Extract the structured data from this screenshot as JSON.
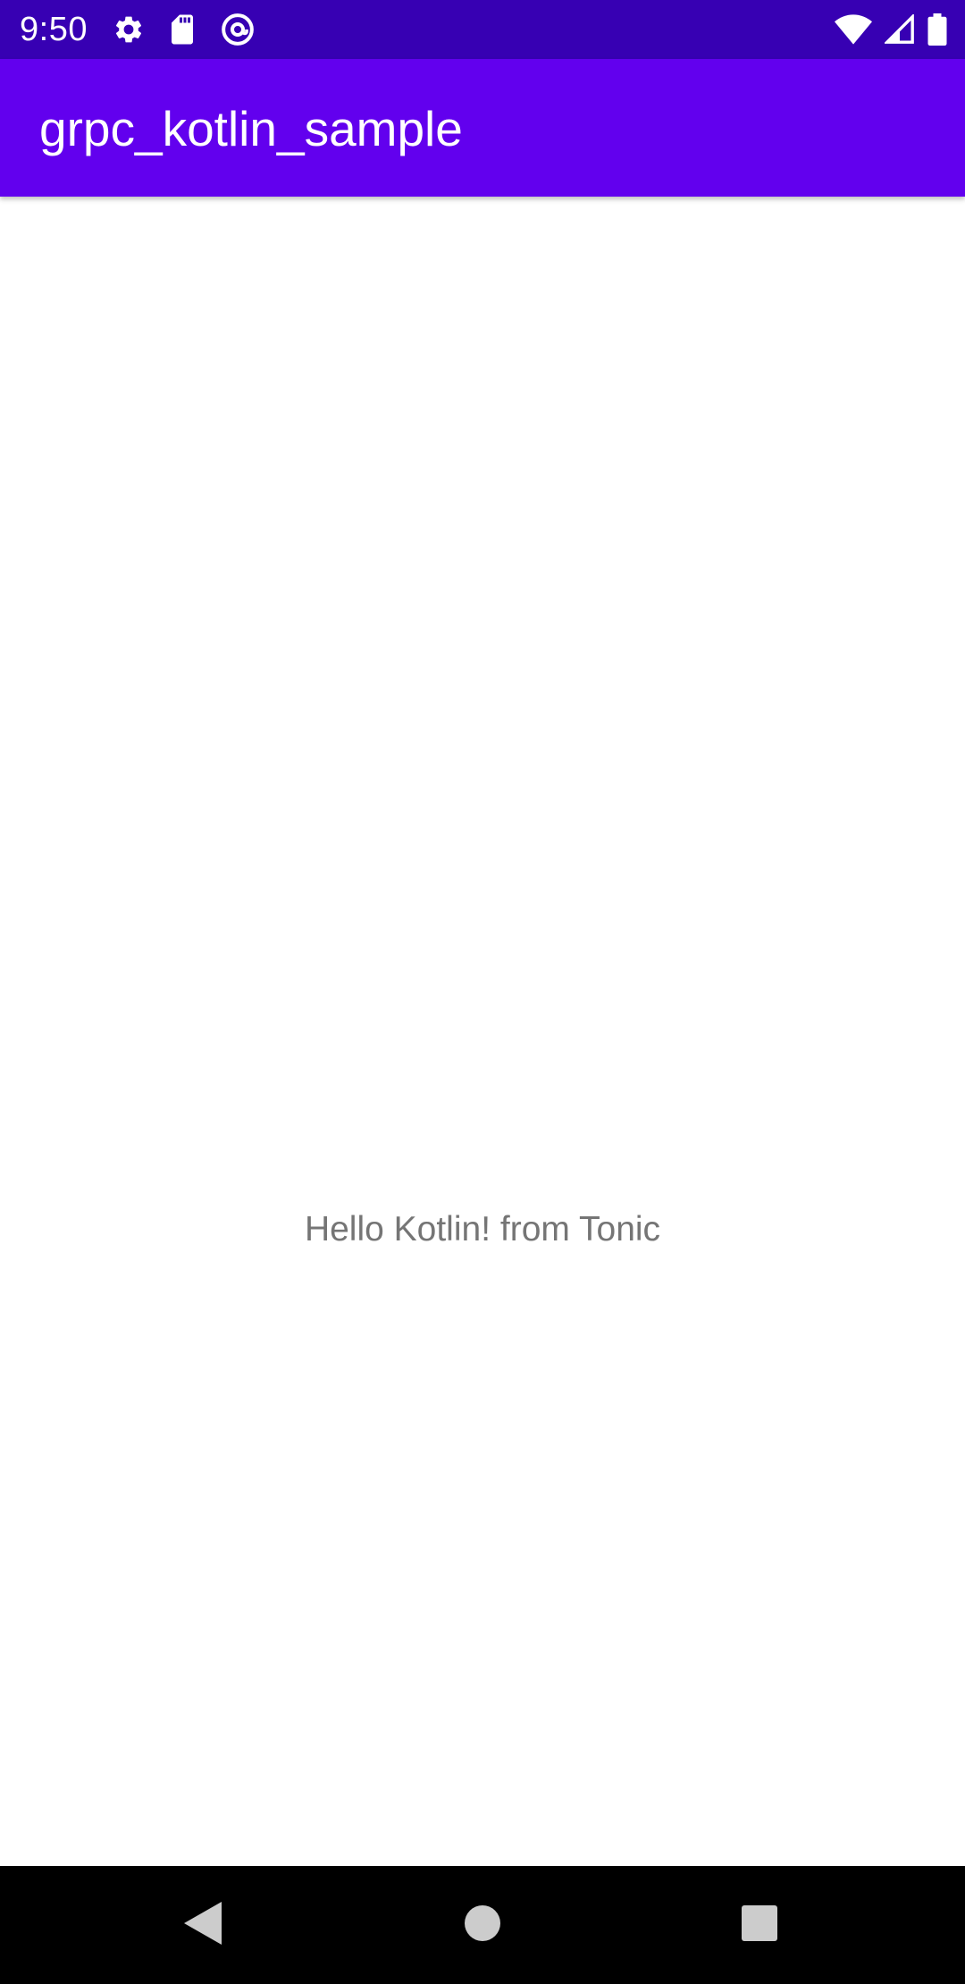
{
  "status_bar": {
    "time": "9:50",
    "background": "#3700b3",
    "left_icons": [
      "settings-gear-icon",
      "sd-card-icon",
      "vpn-at-icon"
    ],
    "right_icons": [
      "wifi-icon",
      "cellular-signal-icon",
      "battery-icon"
    ]
  },
  "app_bar": {
    "title": "grpc_kotlin_sample",
    "background": "#6200ee"
  },
  "main": {
    "message": "Hello Kotlin! from Tonic"
  },
  "nav_bar": {
    "buttons": [
      "back-icon",
      "home-icon",
      "recents-icon"
    ],
    "background": "#000000"
  }
}
